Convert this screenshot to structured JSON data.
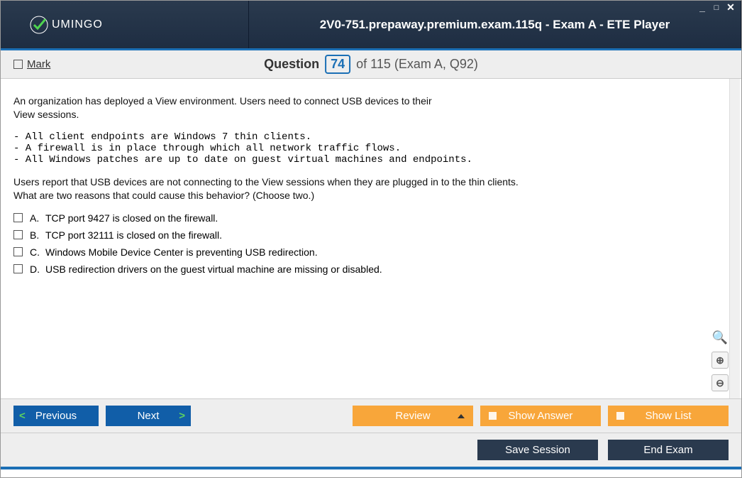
{
  "logo": {
    "text": "UMINGO"
  },
  "window_title": "2V0-751.prepaway.premium.exam.115q - Exam A - ETE Player",
  "header": {
    "mark_label": "Mark",
    "question_word": "Question",
    "question_num": "74",
    "of_text": "of 115 (Exam A, Q92)"
  },
  "question": {
    "intro": "An organization has deployed a View environment. Users need to connect USB devices to their\nView sessions.",
    "mono": "- All client endpoints are Windows 7 thin clients.\n- A firewall is in place through which all network traffic flows.\n- All Windows patches are up to date on guest virtual machines and endpoints.",
    "outro": "Users report that USB devices are not connecting to the View sessions when they are plugged in to the thin clients.\nWhat are two reasons that could cause this behavior? (Choose two.)"
  },
  "answers": [
    {
      "letter": "A.",
      "text": "TCP port 9427 is closed on the firewall."
    },
    {
      "letter": "B.",
      "text": "TCP port 32111 is closed on the firewall."
    },
    {
      "letter": "C.",
      "text": "Windows Mobile Device Center is preventing USB redirection."
    },
    {
      "letter": "D.",
      "text": "USB redirection drivers on the guest virtual machine are missing or disabled."
    }
  ],
  "nav": {
    "previous": "Previous",
    "next": "Next",
    "review": "Review",
    "show_answer": "Show Answer",
    "show_list": "Show List",
    "save_session": "Save Session",
    "end_exam": "End Exam"
  }
}
